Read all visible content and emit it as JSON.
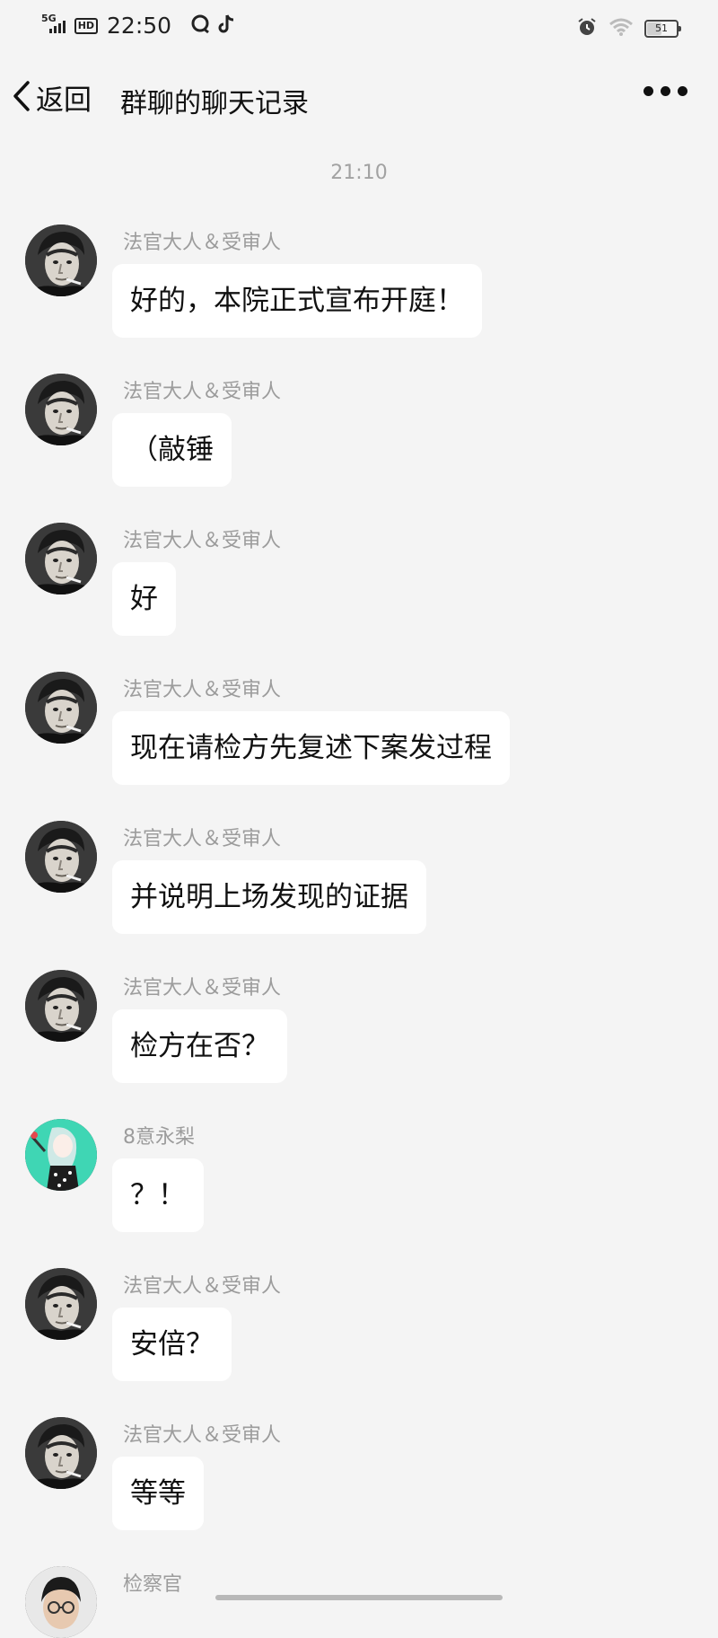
{
  "status_bar": {
    "network": "5G",
    "hd": "HD",
    "time": "22:50",
    "battery": "51",
    "battery_level": 0.51
  },
  "nav": {
    "back_label": "返回",
    "title": "群聊的聊天记录"
  },
  "timestamp": "21:10",
  "messages": [
    {
      "sender": "法官大人＆受审人",
      "text": "好的，本院正式宣布开庭！",
      "avatar": "portrait-man-smoking"
    },
    {
      "sender": "法官大人＆受审人",
      "text": "（敲锤",
      "avatar": "portrait-man-smoking"
    },
    {
      "sender": "法官大人＆受审人",
      "text": "好",
      "avatar": "portrait-man-smoking"
    },
    {
      "sender": "法官大人＆受审人",
      "text": "现在请检方先复述下案发过程",
      "avatar": "portrait-man-smoking"
    },
    {
      "sender": "法官大人＆受审人",
      "text": "并说明上场发现的证据",
      "avatar": "portrait-man-smoking"
    },
    {
      "sender": "法官大人＆受审人",
      "text": "检方在否？",
      "avatar": "portrait-man-smoking"
    },
    {
      "sender": "8意永梨",
      "text": "？！",
      "avatar": "anime-girl-teal"
    },
    {
      "sender": "法官大人＆受审人",
      "text": "安倍？",
      "avatar": "portrait-man-smoking"
    },
    {
      "sender": "法官大人＆受审人",
      "text": "等等",
      "avatar": "portrait-man-smoking"
    },
    {
      "sender": "检察官",
      "text": "",
      "avatar": "portrait-man-glasses"
    }
  ]
}
